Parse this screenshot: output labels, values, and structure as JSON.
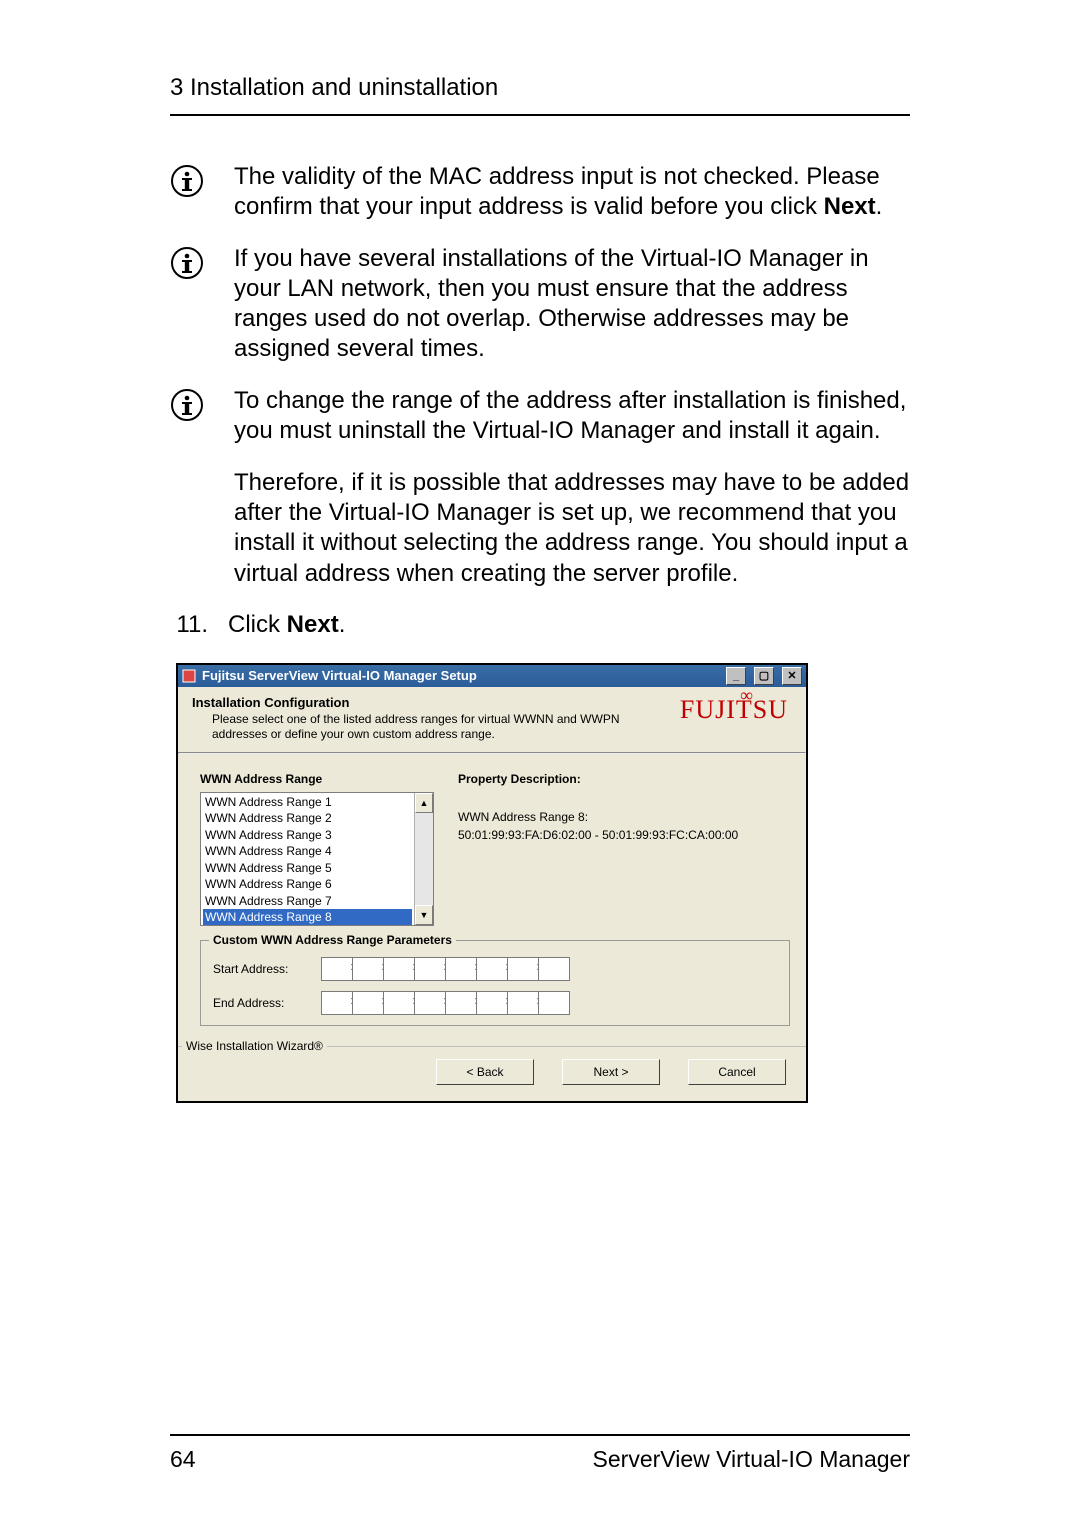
{
  "header": {
    "section_title": "3 Installation and uninstallation"
  },
  "notes": {
    "n1_text_a": "The validity of the MAC address input is not checked. Please confirm that your input address is valid before you click ",
    "n1_bold": "Next",
    "n1_text_b": ".",
    "n2_text": "If you have several installations of the Virtual-IO Manager in your LAN network, then you must ensure that the address ranges used do not overlap. Otherwise addresses may be assigned several times.",
    "n3_text": "To change the range of the address after installation is finished, you must uninstall the Virtual-IO Manager and install it again.",
    "p4_text": "Therefore, if it is possible that addresses may have to be added after the Virtual-IO Manager is set up, we recommend that you install it without selecting the address range. You should input a virtual address when creating the server profile."
  },
  "step": {
    "num": "11.",
    "text_a": "Click ",
    "bold": "Next",
    "text_b": "."
  },
  "window": {
    "title": "Fujitsu ServerView Virtual-IO Manager Setup",
    "install_head": "Installation Configuration",
    "install_sub": "Please select one of the listed address ranges for virtual WWNN and WWPN addresses or define your own custom address range.",
    "logo": "FUJITSU",
    "left_head": "WWN Address Range",
    "right_head": "Property Description:",
    "items": [
      "WWN Address Range 1",
      "WWN Address Range 2",
      "WWN Address Range 3",
      "WWN Address Range 4",
      "WWN Address Range 5",
      "WWN Address Range 6",
      "WWN Address Range 7",
      "WWN Address Range 8"
    ],
    "selected_index": 7,
    "desc_title": "WWN Address Range 8:",
    "desc_value": "50:01:99:93:FA:D6:02:00 - 50:01:99:93:FC:CA:00:00",
    "custom_legend": "Custom WWN Address Range Parameters",
    "start_label": "Start Address:",
    "end_label": "End Address:",
    "wise": "Wise Installation Wizard®",
    "btn_back": "< Back",
    "btn_next": "Next >",
    "btn_cancel": "Cancel"
  },
  "footer": {
    "page": "64",
    "product": "ServerView Virtual-IO Manager"
  }
}
